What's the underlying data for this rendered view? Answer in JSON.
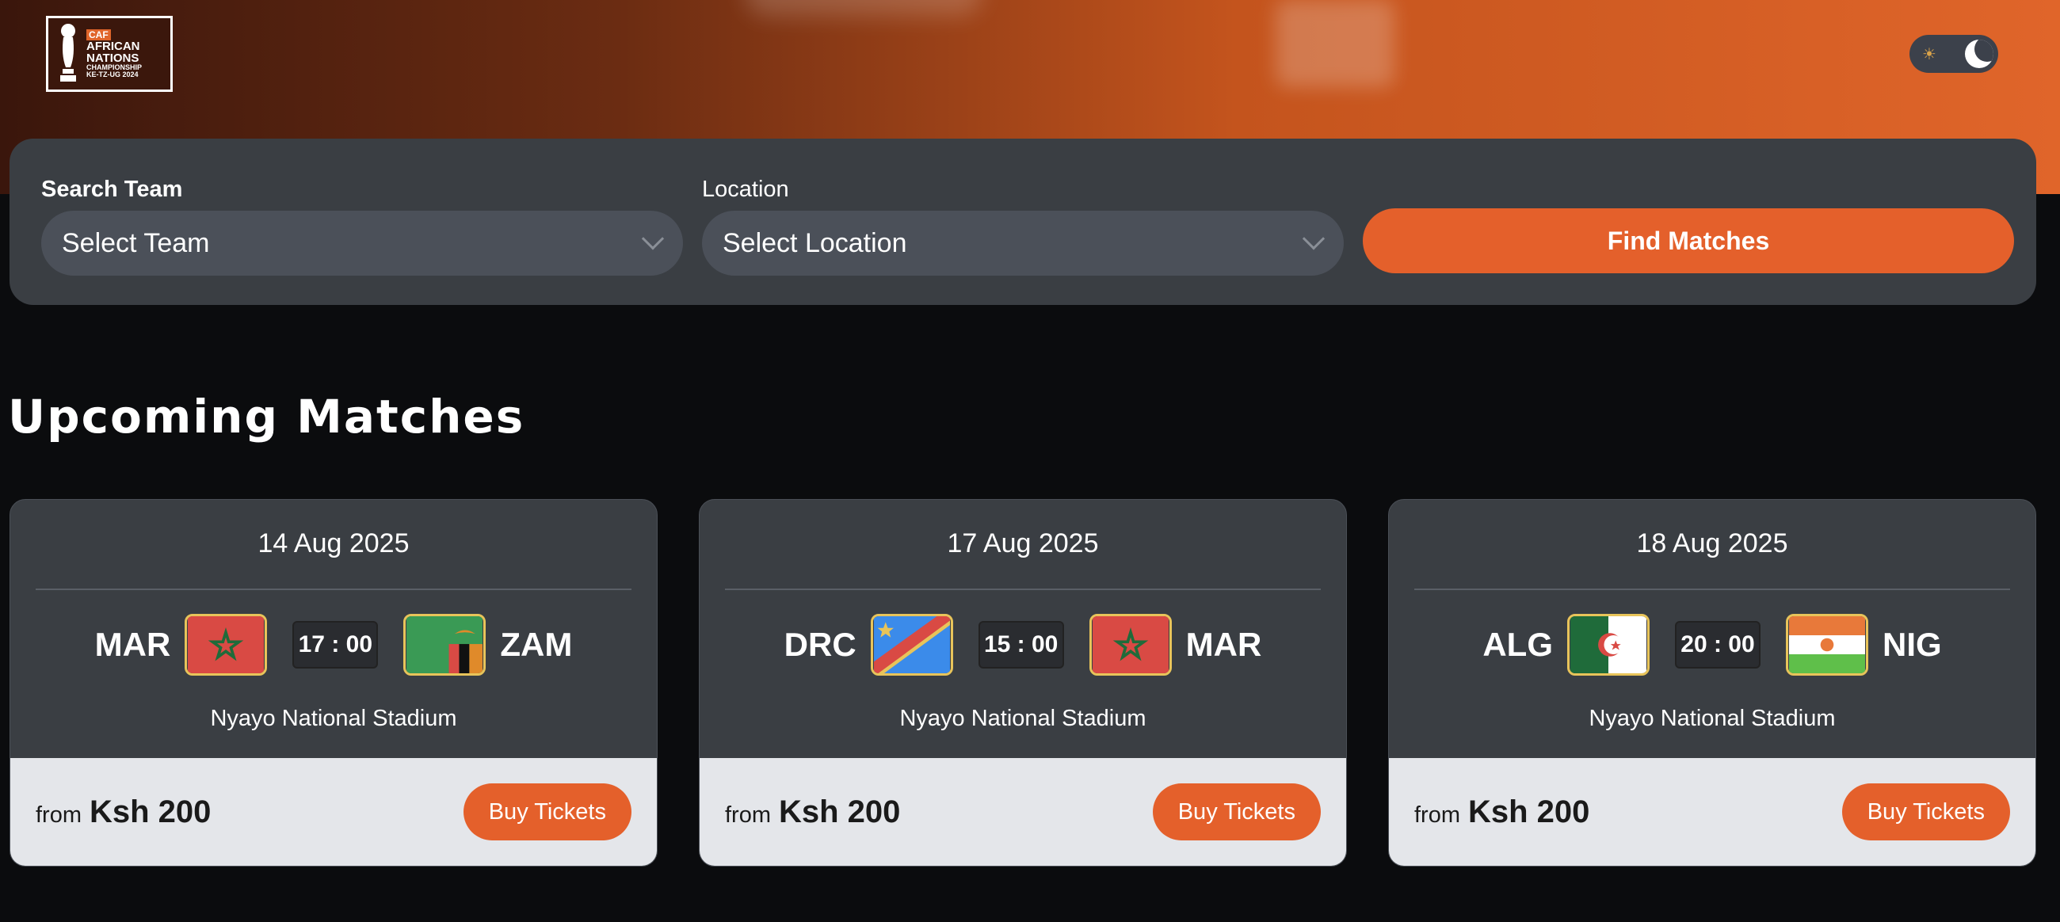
{
  "logo": {
    "caf": "CAF",
    "line1": "AFRICAN",
    "line2": "NATIONS",
    "line3": "CHAMPIONSHIP",
    "line4": "KE-TZ-UG 2024"
  },
  "search": {
    "team_label": "Search Team",
    "team_placeholder": "Select Team",
    "location_label": "Location",
    "location_placeholder": "Select Location",
    "find_label": "Find Matches"
  },
  "section_title": "Upcoming Matches",
  "colors": {
    "accent": "#e4602b",
    "panel": "#3a3e43",
    "background": "#0b0c0e"
  },
  "matches": [
    {
      "date": "14 Aug 2025",
      "home": "MAR",
      "away": "ZAM",
      "time": "17 : 00",
      "venue": "Nyayo National Stadium",
      "from": "from",
      "price": "Ksh 200",
      "buy": "Buy Tickets",
      "home_flag": "morocco-flag-icon",
      "away_flag": "zambia-flag-icon"
    },
    {
      "date": "17 Aug 2025",
      "home": "DRC",
      "away": "MAR",
      "time": "15 : 00",
      "venue": "Nyayo National Stadium",
      "from": "from",
      "price": "Ksh 200",
      "buy": "Buy Tickets",
      "home_flag": "drc-flag-icon",
      "away_flag": "morocco-flag-icon"
    },
    {
      "date": "18 Aug 2025",
      "home": "ALG",
      "away": "NIG",
      "time": "20 : 00",
      "venue": "Nyayo National Stadium",
      "from": "from",
      "price": "Ksh 200",
      "buy": "Buy Tickets",
      "home_flag": "algeria-flag-icon",
      "away_flag": "niger-flag-icon"
    }
  ]
}
